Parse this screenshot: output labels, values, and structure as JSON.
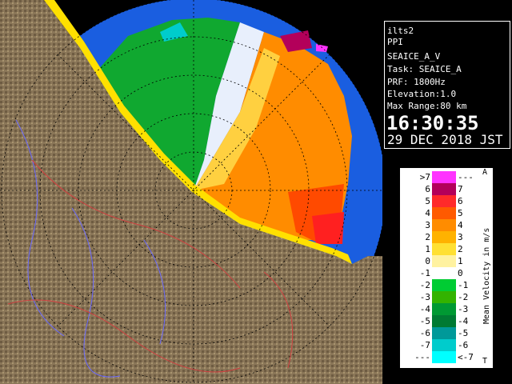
{
  "info": {
    "site": "ilts2",
    "mode": "PPI",
    "product": "SEAICE_A_V",
    "task": "Task: SEAICE_A",
    "prf": "PRF: 1800Hz",
    "elevation": "Elevation:1.0",
    "max_range": "Max Range:80 km",
    "time": "16:30:35",
    "date": "29 DEC 2018 JST"
  },
  "legend": {
    "title": "Mean Velocity in m/s",
    "top_marker": "A",
    "bottom_marker": "T",
    "rows": [
      {
        "left": ">7",
        "right": "---",
        "color": "#ff33ff"
      },
      {
        "left": "6",
        "right": "7",
        "color": "#b3005a"
      },
      {
        "left": "5",
        "right": "6",
        "color": "#ff2a2a"
      },
      {
        "left": "4",
        "right": "5",
        "color": "#ff5a00"
      },
      {
        "left": "3",
        "right": "4",
        "color": "#ff8c00"
      },
      {
        "left": "2",
        "right": "3",
        "color": "#ffb200"
      },
      {
        "left": "1",
        "right": "2",
        "color": "#ffe033"
      },
      {
        "left": "0",
        "right": "1",
        "color": "#fff2a0"
      },
      {
        "left": "-1",
        "right": "0",
        "color": "#ffffff"
      },
      {
        "left": "-2",
        "right": "-1",
        "color": "#00cc33"
      },
      {
        "left": "-3",
        "right": "-2",
        "color": "#33b300"
      },
      {
        "left": "-4",
        "right": "-3",
        "color": "#009933"
      },
      {
        "left": "-5",
        "right": "-4",
        "color": "#007a33"
      },
      {
        "left": "-6",
        "right": "-5",
        "color": "#009999"
      },
      {
        "left": "-7",
        "right": "-6",
        "color": "#00cccc"
      },
      {
        "left": "---",
        "right": "<-7",
        "color": "#00ffff"
      }
    ]
  },
  "colors": {
    "sea": "#1a5ee0",
    "land": "#8a7658",
    "coast_ice": "#ffe000"
  }
}
